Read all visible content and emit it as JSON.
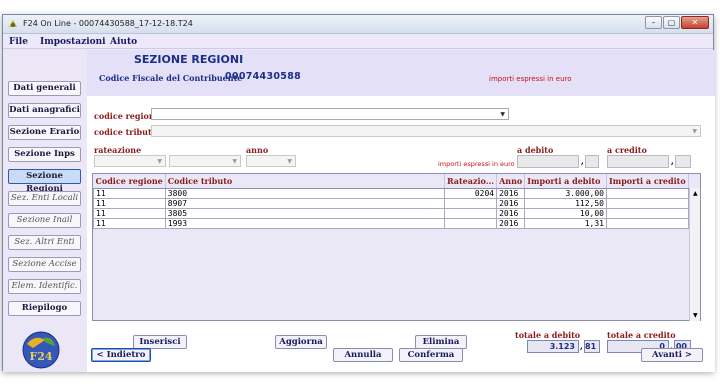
{
  "window": {
    "title": "F24 On Line - 00074430588_17-12-18.T24",
    "min": "–",
    "max": "▢",
    "close": "✕"
  },
  "menu": [
    "File",
    "Impostazioni",
    "Aiuto"
  ],
  "sidebar": {
    "items": [
      {
        "label": "Dati generali"
      },
      {
        "label": "Dati anagrafici"
      },
      {
        "label": "Sezione Erario"
      },
      {
        "label": "Sezione Inps"
      },
      {
        "label": "Sezione Regioni"
      },
      {
        "label": "Sez. Enti Locali"
      },
      {
        "label": "Sezione Inail"
      },
      {
        "label": "Sez. Altri Enti"
      },
      {
        "label": "Sezione Accise"
      },
      {
        "label": "Elem. Identific."
      },
      {
        "label": "Riepilogo"
      }
    ],
    "logo_text": "F24"
  },
  "header": {
    "section_title": "SEZIONE REGIONI",
    "cf_label": "Codice Fiscale del Contribuente",
    "cf_value": "00074430588",
    "currency_note": "importi espressi in euro"
  },
  "form": {
    "codice_regione_label": "codice regione",
    "codice_tributo_label": "codice tributo",
    "rateazione_label": "rateazione",
    "anno_label": "anno",
    "small_currency_note": "importi espressi in euro",
    "a_debito_label": "a debito",
    "a_credito_label": "a credito",
    "comma": ","
  },
  "table": {
    "columns": [
      "Codice regione",
      "Codice tributo",
      "Rateazio...",
      "Anno",
      "Importi a debito",
      "Importi a credito"
    ],
    "rows": [
      [
        "11",
        "3800",
        "0204",
        "2016",
        "3.000,00",
        ""
      ],
      [
        "11",
        "8907",
        "",
        "2016",
        "112,50",
        ""
      ],
      [
        "11",
        "3805",
        "",
        "2016",
        "10,00",
        ""
      ],
      [
        "11",
        "1993",
        "",
        "2016",
        "1,31",
        ""
      ]
    ]
  },
  "actions": {
    "inserisci": "Inserisci",
    "aggiorna": "Aggiorna",
    "elimina": "Elimina"
  },
  "totals": {
    "debito_label": "totale a debito",
    "credito_label": "totale a credito",
    "debito_int": "3.123",
    "debito_dec": "81",
    "credito_int": "0",
    "credito_dec": "00"
  },
  "footer": {
    "indietro": "< Indietro",
    "annulla": "Annulla",
    "conferma": "Conferma",
    "avanti": "Avanti >"
  },
  "colors": {
    "accent_blue": "#1c2d8a",
    "label_red": "#8b1a1a",
    "note_red": "#cc1111",
    "panel": "#e3e0f7"
  }
}
